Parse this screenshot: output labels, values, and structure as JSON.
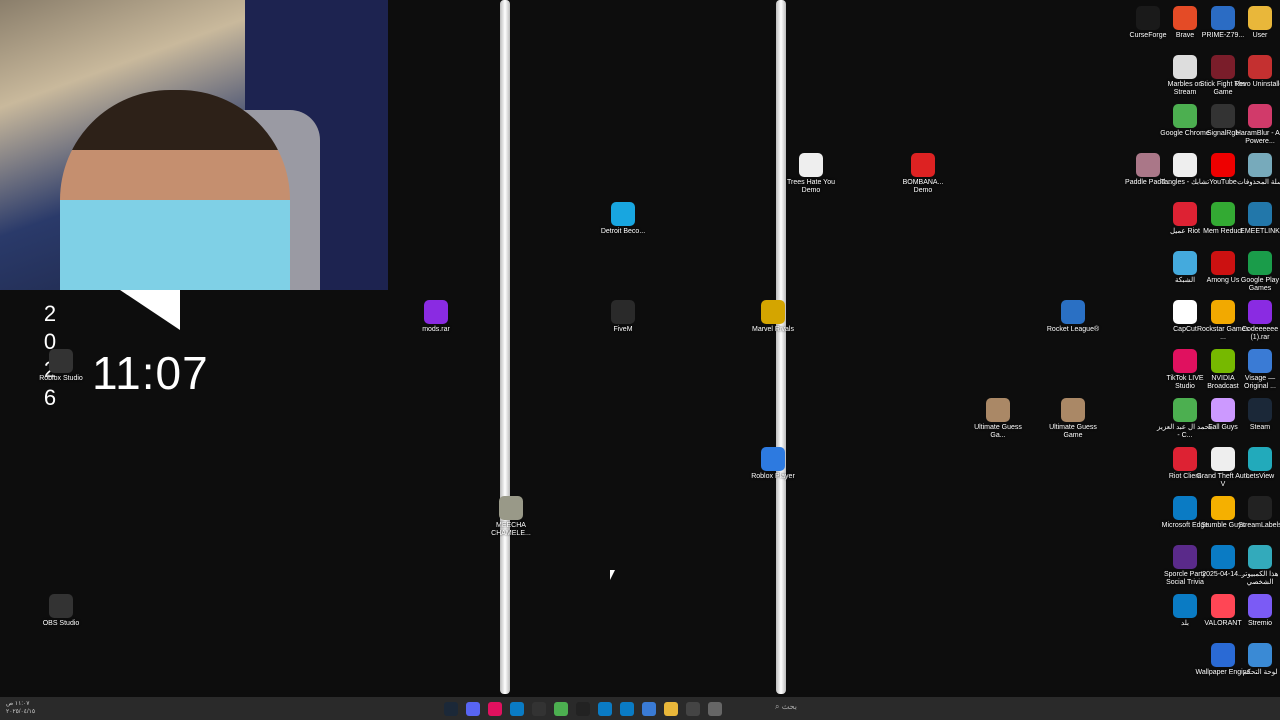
{
  "overlay": {
    "clock": "11:07",
    "vertical_digits": [
      "2",
      "0",
      "2",
      "6"
    ]
  },
  "desktop_icons": [
    {
      "label": "CurseForge",
      "icon": "curseforge-icon",
      "color": "#1a1a1a"
    },
    {
      "label": "Brave",
      "icon": "brave-icon",
      "color": "#e44b26"
    },
    {
      "label": "PRIME-Z79...",
      "icon": "document-icon",
      "color": "#2b6cc4"
    },
    {
      "label": "User",
      "icon": "folder-icon",
      "color": "#e9b73a"
    },
    {
      "label": "Marbles on Stream",
      "icon": "marbles-icon",
      "color": "#ddd"
    },
    {
      "label": "Stick Fight The Game",
      "icon": "stickfight-icon",
      "color": "#7a1d2a"
    },
    {
      "label": "Revo Uninstaller",
      "icon": "revo-icon",
      "color": "#c43030"
    },
    {
      "label": "Google Chrome",
      "icon": "chrome-icon",
      "color": "#4caf50"
    },
    {
      "label": "SignalRgb",
      "icon": "signalrgb-icon",
      "color": "#333"
    },
    {
      "label": "HaramBlur - AI-Powere...",
      "icon": "haramblur-icon",
      "color": "#d13a6a"
    },
    {
      "label": "Paddle Padd...",
      "icon": "paddle-icon",
      "color": "#a78"
    },
    {
      "label": "Tangles - تشابك",
      "icon": "tangles-icon",
      "color": "#eee"
    },
    {
      "label": "YouTube",
      "icon": "youtube-icon",
      "color": "#e00"
    },
    {
      "label": "سلة المحذوفات",
      "icon": "recycle-bin-icon",
      "color": "#7ab"
    },
    {
      "label": "عميل Riot",
      "icon": "riot-icon",
      "color": "#d23"
    },
    {
      "label": "Mem Reduct",
      "icon": "memreduct-icon",
      "color": "#3a3"
    },
    {
      "label": "EMEETLINK",
      "icon": "emeetlink-icon",
      "color": "#27a"
    },
    {
      "label": "الشبكة",
      "icon": "network-icon",
      "color": "#4ad"
    },
    {
      "label": "Among Us",
      "icon": "amongus-icon",
      "color": "#c11"
    },
    {
      "label": "Google Play Games",
      "icon": "playgames-icon",
      "color": "#1a9c4a"
    },
    {
      "label": "CapCut",
      "icon": "capcut-icon",
      "color": "#fff"
    },
    {
      "label": "Rockstar Games ...",
      "icon": "rockstar-icon",
      "color": "#f2a900"
    },
    {
      "label": "Codeeeeee (1).rar",
      "icon": "winrar-icon",
      "color": "#8a2be2"
    },
    {
      "label": "TikTok LIVE Studio",
      "icon": "tiktok-icon",
      "color": "#e0115f"
    },
    {
      "label": "NVIDIA Broadcast",
      "icon": "nvidia-icon",
      "color": "#76b900"
    },
    {
      "label": "Visage — Original ...",
      "icon": "visage-icon",
      "color": "#3a7bd5"
    },
    {
      "label": "محمد ال عبد العزيز - C...",
      "icon": "chrome-icon",
      "color": "#4caf50"
    },
    {
      "label": "Fall Guys",
      "icon": "fallguys-icon",
      "color": "#c9f"
    },
    {
      "label": "Steam",
      "icon": "steam-icon",
      "color": "#1b2838"
    },
    {
      "label": "Riot Client",
      "icon": "riot-icon",
      "color": "#d23"
    },
    {
      "label": "Grand Theft Auto V",
      "icon": "document-icon",
      "color": "#eee"
    },
    {
      "label": "LetsView",
      "icon": "letsview-icon",
      "color": "#2ab"
    },
    {
      "label": "Microsoft Edge",
      "icon": "edge-icon",
      "color": "#0a7bc4"
    },
    {
      "label": "Stumble Guys",
      "icon": "stumble-icon",
      "color": "#f5b000"
    },
    {
      "label": "StreamLabels",
      "icon": "streamlabels-icon",
      "color": "#222"
    },
    {
      "label": "Sporcle Party Social Trivia",
      "icon": "sporcle-icon",
      "color": "#5a2a8a"
    },
    {
      "label": "2025-04-14...",
      "icon": "edge-icon",
      "color": "#0a7bc4"
    },
    {
      "label": "هذا الكمبيوتر الشخصي",
      "icon": "pc-icon",
      "color": "#3ab"
    },
    {
      "label": "بلد",
      "icon": "edge-icon",
      "color": "#0a7bc4"
    },
    {
      "label": "VALORANT",
      "icon": "valorant-icon",
      "color": "#ff4655"
    },
    {
      "label": "Stremio",
      "icon": "stremio-icon",
      "color": "#7b5bf5"
    },
    {
      "label": "Wallpaper Engine",
      "icon": "wallpaper-icon",
      "color": "#2a6ad5"
    },
    {
      "label": "لوحة التحكم",
      "icon": "controlpanel-icon",
      "color": "#3a8ad5"
    },
    {
      "label": "Trees Hate You Demo",
      "icon": "tree-icon",
      "color": "#eee"
    },
    {
      "label": "BOMBANA... Demo",
      "icon": "bombana-icon",
      "color": "#d22"
    },
    {
      "label": "Detroit Beco...",
      "icon": "detroit-icon",
      "color": "#18a6e0"
    },
    {
      "label": "mods.rar",
      "icon": "winrar-icon",
      "color": "#8a2be2"
    },
    {
      "label": "FiveM",
      "icon": "fivem-icon",
      "color": "#2a2a2a"
    },
    {
      "label": "Marvel Rivals",
      "icon": "marvel-icon",
      "color": "#d4a500"
    },
    {
      "label": "Rocket League®",
      "icon": "rocketleague-icon",
      "color": "#2a70c4"
    },
    {
      "label": "Ultimate Guess Ga...",
      "icon": "guessgame-icon",
      "color": "#a86"
    },
    {
      "label": "Ultimate Guess Game",
      "icon": "guessgame-icon",
      "color": "#a86"
    },
    {
      "label": "Roblox Player",
      "icon": "roblox-icon",
      "color": "#2d7ae0"
    },
    {
      "label": "MEECHA CHAMELE...",
      "icon": "meecha-icon",
      "color": "#998"
    },
    {
      "label": "Roblox Studio",
      "icon": "roblox-studio-icon",
      "color": "#333"
    },
    {
      "label": "OBS Studio",
      "icon": "obs-icon",
      "color": "#333"
    }
  ],
  "taskbar": {
    "search_label": "بحث",
    "tray_time": "١١:٠٧ ص",
    "tray_date": "٢٠٢٥/٠٤/١٥",
    "apps": [
      "steam-icon",
      "discord-icon",
      "tiktok-icon",
      "edge-icon",
      "obs-icon",
      "chrome-icon",
      "terminal-icon",
      "vscode-icon",
      "edge-icon",
      "notepad-icon",
      "explorer-icon",
      "window-icon",
      "settings-icon"
    ]
  }
}
